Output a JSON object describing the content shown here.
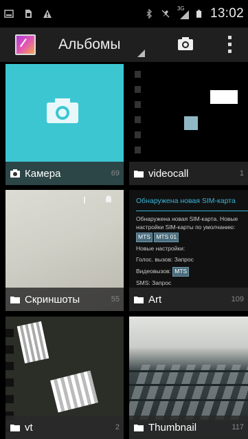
{
  "status_bar": {
    "time": "13:02",
    "network": "3G",
    "icons": [
      "screenshot-icon",
      "sim-icon",
      "warning-icon",
      "bluetooth-icon",
      "mute-icon",
      "signal-icon",
      "battery-icon"
    ]
  },
  "action_bar": {
    "title": "Альбомы",
    "icons": [
      "gallery-app-icon",
      "camera-icon",
      "overflow-menu-icon"
    ]
  },
  "albums": [
    {
      "name": "Камера",
      "count": "69",
      "icon": "camera-icon"
    },
    {
      "name": "videocall",
      "count": "1",
      "icon": "folder-icon"
    },
    {
      "name": "Скриншоты",
      "count": "55",
      "icon": "folder-icon"
    },
    {
      "name": "Art",
      "count": "109",
      "icon": "folder-icon"
    },
    {
      "name": "vt",
      "count": "2",
      "icon": "folder-icon"
    },
    {
      "name": "Thumbnail",
      "count": "117",
      "icon": "folder-icon"
    }
  ],
  "art_preview": {
    "title": "Обнаружена новая SIM-карта",
    "line1": "Обнаружена новая SIM-карта. Новые настройки SIM-карты по умолчанию:",
    "chip1": "MTS",
    "chip2": "MTS 01",
    "line2": "Новые настройки:",
    "line3": "Голос. вызов: Запрос",
    "line4_prefix": "Видеовызов:",
    "chip3": "MTS",
    "line5": "SMS: Запрос"
  },
  "colors": {
    "accent": "#39b6d8",
    "camera_tile": "#3cc6d2",
    "action_bar": "#1f1f1f"
  }
}
